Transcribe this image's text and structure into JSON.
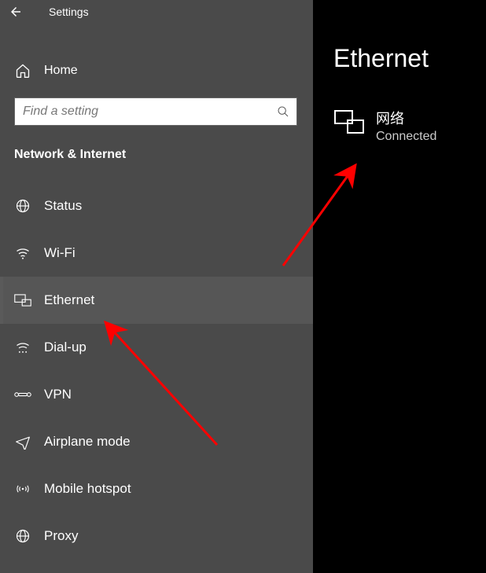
{
  "titlebar": {
    "title": "Settings"
  },
  "home": {
    "label": "Home"
  },
  "search": {
    "placeholder": "Find a setting"
  },
  "section": {
    "header": "Network & Internet"
  },
  "nav": {
    "items": [
      {
        "label": "Status"
      },
      {
        "label": "Wi-Fi"
      },
      {
        "label": "Ethernet"
      },
      {
        "label": "Dial-up"
      },
      {
        "label": "VPN"
      },
      {
        "label": "Airplane mode"
      },
      {
        "label": "Mobile hotspot"
      },
      {
        "label": "Proxy"
      }
    ],
    "selected_index": 2
  },
  "right": {
    "title": "Ethernet",
    "adapter": {
      "name": "网络",
      "status": "Connected"
    }
  }
}
